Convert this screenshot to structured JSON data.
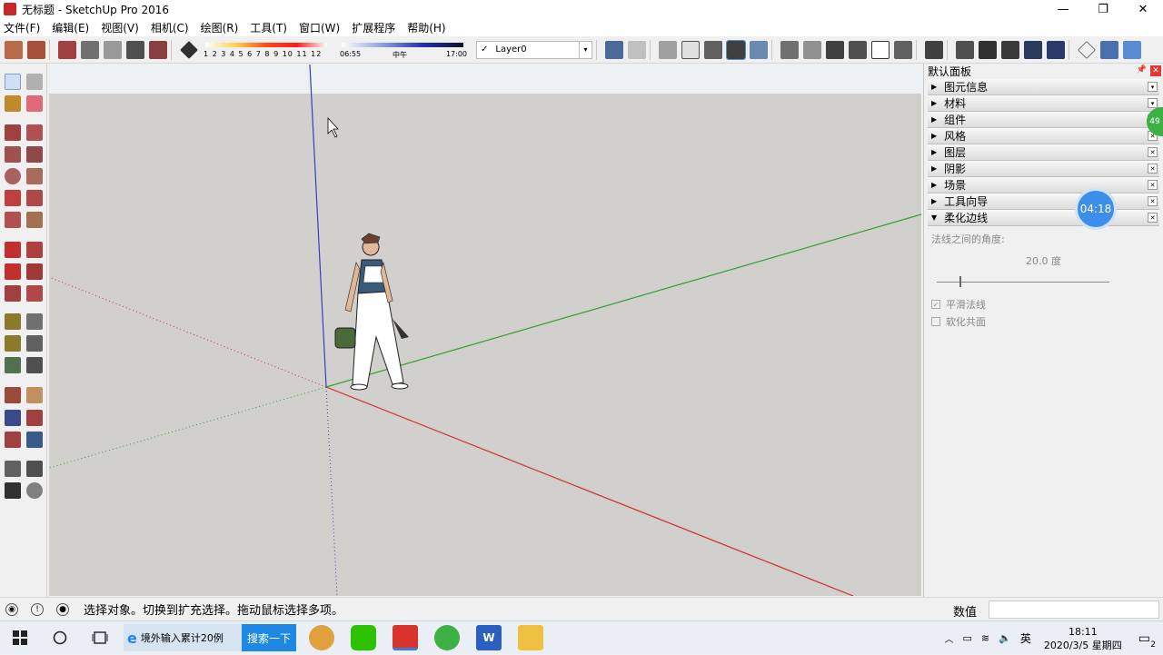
{
  "window": {
    "title": "无标题 - SketchUp Pro 2016",
    "minimize": "—",
    "restore": "❐",
    "close": "✕"
  },
  "menu": [
    "文件(F)",
    "编辑(E)",
    "视图(V)",
    "相机(C)",
    "绘图(R)",
    "工具(T)",
    "窗口(W)",
    "扩展程序",
    "帮助(H)"
  ],
  "toolbar": {
    "shadow_ticks": "1 2 3 4 5 6 7 8 9 10 11 12",
    "time_start": "06:55",
    "time_mid": "中午",
    "time_end": "17:00",
    "layer_check": "✓",
    "layer": "Layer0",
    "layer_dropdown": "▾"
  },
  "panel": {
    "title": "默认面板",
    "pin": "📌",
    "close": "✕",
    "trays": [
      {
        "label": "图元信息",
        "expanded": false
      },
      {
        "label": "材料",
        "expanded": false
      },
      {
        "label": "组件",
        "expanded": false
      },
      {
        "label": "风格",
        "expanded": false
      },
      {
        "label": "图层",
        "expanded": false
      },
      {
        "label": "阴影",
        "expanded": false
      },
      {
        "label": "场景",
        "expanded": false
      },
      {
        "label": "工具向导",
        "expanded": false
      },
      {
        "label": "柔化边线",
        "expanded": true
      }
    ],
    "soften": {
      "angle_label": "法线之间的角度:",
      "angle_value": "20.0",
      "angle_unit": "度",
      "slider_fraction": 0.13,
      "smooth_normals": "平滑法线",
      "smooth_normals_checked": true,
      "soften_coplanar": "软化共面",
      "soften_coplanar_checked": false
    }
  },
  "overlays": {
    "timer": "04:18",
    "green_badge": "49"
  },
  "status": {
    "text": "选择对象。切换到扩充选择。拖动鼠标选择多项。",
    "measure_label": "数值",
    "measure_value": ""
  },
  "taskbar": {
    "ie_label": "境外输入累计20例",
    "search_button": "搜索一下",
    "ime": "英",
    "time": "18:11",
    "date": "2020/3/5 星期四",
    "notif_count": "2"
  },
  "colors": {
    "x_axis": "#d03030",
    "y_axis": "#30a030",
    "z_axis": "#3040c0",
    "viewport_bg": "#d2d0cc"
  }
}
